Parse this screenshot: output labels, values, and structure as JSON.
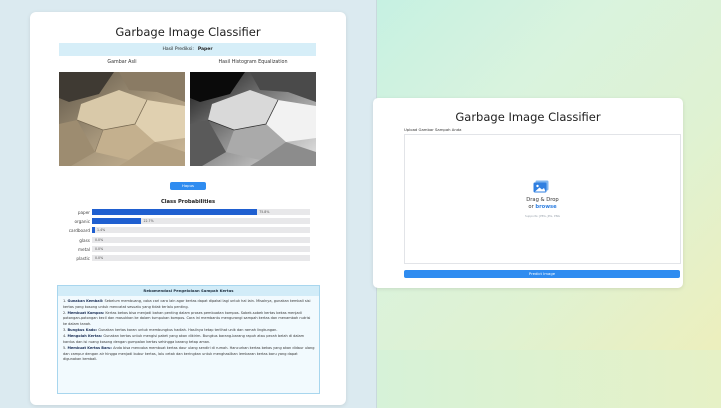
{
  "left": {
    "title": "Garbage Image Classifier",
    "prediction_label": "Hasil Prediksi:",
    "prediction_value": "Paper",
    "original_label": "Gambar Asli",
    "equalized_label": "Hasil Histogram Equalization",
    "delete_button": "Hapus",
    "probabilities_title": "Class Probabilities",
    "chart_data": {
      "type": "bar",
      "title": "Class Probabilities",
      "categories": [
        "paper",
        "organic",
        "cardboard",
        "glass",
        "metal",
        "plastic"
      ],
      "values": [
        75.8,
        22.7,
        1.4,
        0.0,
        0.0,
        0.0
      ],
      "value_labels": [
        "75.8%",
        "22.7%",
        "1.4%",
        "0.0%",
        "0.0%",
        "0.0%"
      ],
      "xlim": [
        0,
        100
      ],
      "bar_color": "#1f5fd0",
      "track_color": "#e8e8ea"
    },
    "recommendation": {
      "title": "Rekomendasi Pengelolaan Sampah Kertas",
      "items": [
        {
          "n": "1.",
          "bold": "Gunakan Kembali:",
          "text": " Sebelum membuang, coba cari cara lain agar kertas dapat dipakai lagi untuk hal lain. Misalnya, gunakan kembali sisi kertas yang kosong untuk mencatat sesuatu yang tidak terlalu penting."
        },
        {
          "n": "2.",
          "bold": "Membuat Kompos:",
          "text": " Kertas bekas bisa menjadi bahan penting dalam proses pembuatan kompos. Sobek-sobek kertas bekas menjadi potongan-potongan kecil dan masukkan ke dalam tumpukan kompos. Cara ini membantu mengurangi sampah kertas dan menambah nutrisi ke dalam tanah."
        },
        {
          "n": "3.",
          "bold": "Bungkus Kado:",
          "text": " Gunakan kertas koran untuk membungkus hadiah. Hasilnya tetap terlihat unik dan ramah lingkungan."
        },
        {
          "n": "4.",
          "bold": "Mengolah Kertas:",
          "text": " Gunakan kertas untuk mengisi paket yang akan dikirim. Bungkus barang-barang rapuh atau pecah belah di dalam kardus dan isi ruang kosong dengan gumpalan kertas sehingga barang tetap aman."
        },
        {
          "n": "5.",
          "bold": "Membuat Kertas Baru:",
          "text": " Anda bisa mencoba membuat kertas daur ulang sendiri di rumah. Hancurkan kertas bekas yang akan didaur ulang dan campur dengan air hingga menjadi bubur kertas, lalu cetak dan keringkan untuk menghasilkan lembaran kertas baru yang dapat digunakan kembali."
        }
      ]
    }
  },
  "right": {
    "title": "Garbage Image Classifier",
    "upload_label": "Upload Gambar Sampah Anda",
    "dropzone_main": "Drag & Drop",
    "dropzone_or": "or",
    "dropzone_browse": "browse",
    "dropzone_supports": "Supports: JPEG, JPG, PNG",
    "predict_button": "Predict Image"
  },
  "colors": {
    "accent": "#2f8cf0",
    "bar_fill": "#1f5fd0",
    "prediction_bg": "#d6eef8",
    "recommendation_border": "#a8d6ee"
  }
}
